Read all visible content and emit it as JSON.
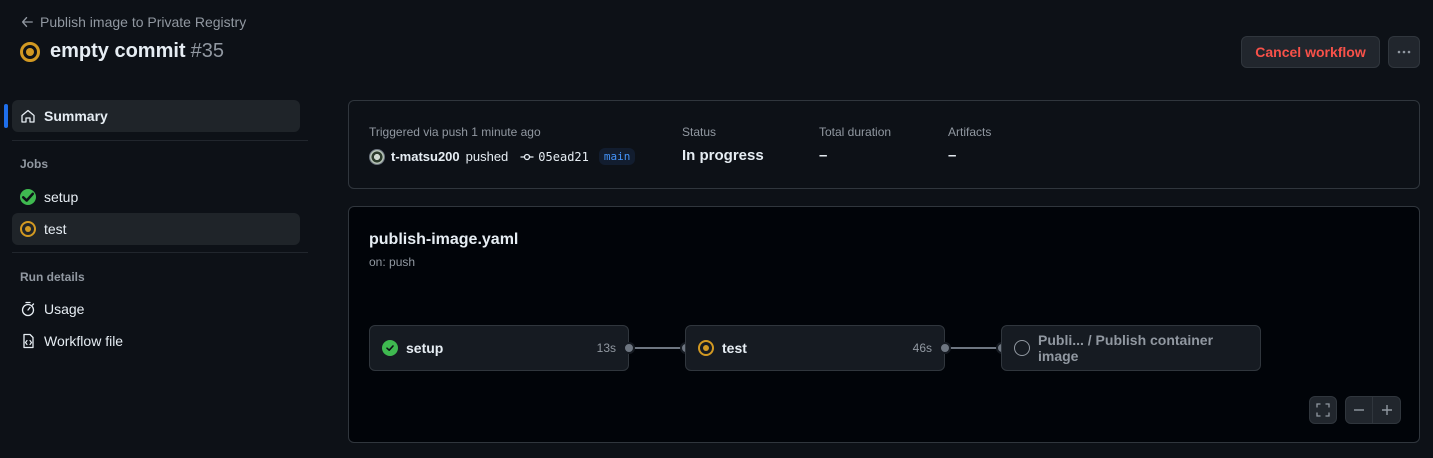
{
  "header": {
    "back_label": "Publish image to Private Registry",
    "title": "empty commit",
    "run_number": "#35",
    "cancel_label": "Cancel workflow"
  },
  "sidebar": {
    "summary_label": "Summary",
    "jobs_heading": "Jobs",
    "jobs": [
      {
        "label": "setup",
        "status": "success"
      },
      {
        "label": "test",
        "status": "in_progress"
      }
    ],
    "run_details_heading": "Run details",
    "details": [
      {
        "label": "Usage",
        "icon": "stopwatch-icon"
      },
      {
        "label": "Workflow file",
        "icon": "file-code-icon"
      }
    ]
  },
  "summary": {
    "trigger_label": "Triggered via push 1 minute ago",
    "user": "t-matsu200",
    "action": "pushed",
    "commit": "05ead21",
    "branch": "main",
    "status_label": "Status",
    "status_value": "In progress",
    "duration_label": "Total duration",
    "duration_value": "–",
    "artifacts_label": "Artifacts",
    "artifacts_value": "–"
  },
  "graph": {
    "file_name": "publish-image.yaml",
    "trigger": "on: push",
    "nodes": [
      {
        "name": "setup",
        "duration": "13s",
        "status": "success"
      },
      {
        "name": "test",
        "duration": "46s",
        "status": "in_progress"
      },
      {
        "name": "Publi... / Publish container image",
        "duration": "",
        "status": "pending"
      }
    ]
  },
  "colors": {
    "accent": "#1f6feb",
    "success": "#3fb950",
    "in_progress": "#d29922",
    "danger": "#f85149"
  }
}
